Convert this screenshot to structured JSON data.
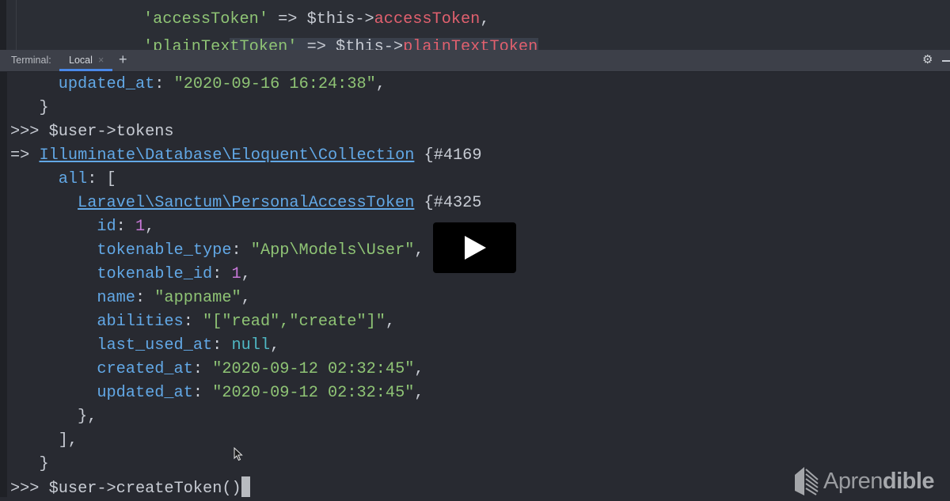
{
  "editor": {
    "lines": [
      [
        [
          "str",
          "'accessToken'"
        ],
        [
          "txt",
          " => $this->"
        ],
        [
          "red",
          "accessToken"
        ],
        [
          "txt",
          ","
        ]
      ],
      [
        [
          "str",
          "'plainTextToken'"
        ],
        [
          "txt",
          " => $this->"
        ],
        [
          "red",
          "plainTextToken"
        ]
      ]
    ]
  },
  "terminal_header": {
    "label": "Terminal:",
    "tab_label": "Local",
    "tab_close": "×",
    "add": "+"
  },
  "terminal": {
    "lines": [
      [
        [
          "key",
          "updated_at"
        ],
        [
          "txt",
          ": "
        ],
        [
          "str",
          "\"2020-09-16 16:24:38\""
        ],
        [
          "txt",
          ","
        ]
      ],
      [
        [
          "txt",
          "}"
        ]
      ],
      [
        [
          "txt",
          ">>> $user->tokens"
        ]
      ],
      [
        [
          "txt",
          "=> "
        ],
        [
          "link",
          "Illuminate\\Database\\Eloquent\\Collection"
        ],
        [
          "txt",
          " {#4169"
        ]
      ],
      [
        [
          "key",
          "all"
        ],
        [
          "txt",
          ": ["
        ]
      ],
      [
        [
          "link",
          "Laravel\\Sanctum\\PersonalAccessToken"
        ],
        [
          "txt",
          " {#4325"
        ]
      ],
      [
        [
          "key",
          "id"
        ],
        [
          "txt",
          ": "
        ],
        [
          "num",
          "1"
        ],
        [
          "txt",
          ","
        ]
      ],
      [
        [
          "key",
          "tokenable_type"
        ],
        [
          "txt",
          ": "
        ],
        [
          "str",
          "\"App\\Models\\User\""
        ],
        [
          "txt",
          ","
        ]
      ],
      [
        [
          "key",
          "tokenable_id"
        ],
        [
          "txt",
          ": "
        ],
        [
          "num",
          "1"
        ],
        [
          "txt",
          ","
        ]
      ],
      [
        [
          "key",
          "name"
        ],
        [
          "txt",
          ": "
        ],
        [
          "str",
          "\"appname\""
        ],
        [
          "txt",
          ","
        ]
      ],
      [
        [
          "key",
          "abilities"
        ],
        [
          "txt",
          ": "
        ],
        [
          "str",
          "\"[\"read\",\"create\"]\""
        ],
        [
          "txt",
          ","
        ]
      ],
      [
        [
          "key",
          "last_used_at"
        ],
        [
          "txt",
          ": "
        ],
        [
          "nul",
          "null"
        ],
        [
          "txt",
          ","
        ]
      ],
      [
        [
          "key",
          "created_at"
        ],
        [
          "txt",
          ": "
        ],
        [
          "str",
          "\"2020-09-12 02:32:45\""
        ],
        [
          "txt",
          ","
        ]
      ],
      [
        [
          "key",
          "updated_at"
        ],
        [
          "txt",
          ": "
        ],
        [
          "str",
          "\"2020-09-12 02:32:45\""
        ],
        [
          "txt",
          ","
        ]
      ],
      [
        [
          "txt",
          "},"
        ]
      ],
      [
        [
          "txt",
          "],"
        ]
      ],
      [
        [
          "txt",
          "}"
        ]
      ],
      [
        [
          "txt",
          ">>> $user->createToken()"
        ]
      ]
    ]
  },
  "logo": {
    "text_light": "Apren",
    "text_bold": "dible",
    "full": "Aprendible"
  },
  "colors": {
    "background": "#282a31",
    "key": "#62a8e6",
    "string": "#8fc475",
    "number": "#c878d8",
    "null": "#4fb8c4",
    "property": "#e0606e"
  }
}
